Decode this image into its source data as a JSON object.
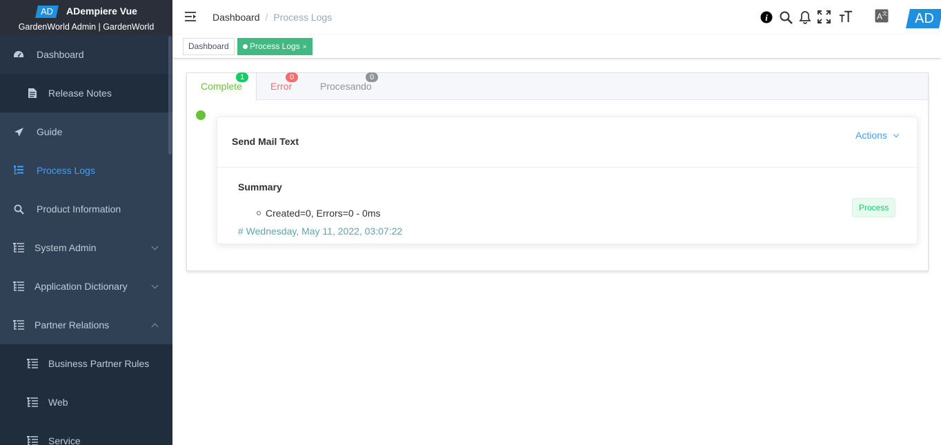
{
  "brand": {
    "logo_text": "AD",
    "app_name": "ADempiere Vue",
    "org": "GardenWorld Admin | GardenWorld"
  },
  "sidebar": {
    "items": [
      {
        "label": "Dashboard",
        "icon": "dashboard-icon"
      },
      {
        "label": "Release Notes",
        "icon": "document-icon"
      },
      {
        "label": "Guide",
        "icon": "paper-plane-icon"
      },
      {
        "label": "Process Logs",
        "icon": "tree-table-icon",
        "active": true
      },
      {
        "label": "Product Information",
        "icon": "search-icon"
      },
      {
        "label": "System Admin",
        "icon": "tree-icon",
        "expanded": false
      },
      {
        "label": "Application Dictionary",
        "icon": "tree-icon",
        "expanded": false
      },
      {
        "label": "Partner Relations",
        "icon": "tree-icon",
        "expanded": true
      },
      {
        "label": "Business Partner Rules",
        "icon": "tree-icon"
      },
      {
        "label": "Web",
        "icon": "tree-icon"
      },
      {
        "label": "Service",
        "icon": "tree-icon"
      }
    ]
  },
  "navbar": {
    "breadcrumb": [
      "Dashboard",
      "Process Logs"
    ],
    "logo_text": "AD"
  },
  "tags": {
    "dashboard": "Dashboard",
    "process_logs": "Process Logs",
    "close": "×"
  },
  "tabs": [
    {
      "label": "Complete",
      "count": "1"
    },
    {
      "label": "Error",
      "count": "0"
    },
    {
      "label": "Procesando",
      "count": "0"
    }
  ],
  "log": {
    "title": "Send Mail Text",
    "actions_label": "Actions",
    "summary_title": "Summary",
    "summary_text": "Created=0, Errors=0 - 0ms",
    "date": "# Wednesday, May 11, 2022, 03:07:22",
    "tag": "Process"
  },
  "colors": {
    "sidebar_bg": "#304156",
    "brand_bg": "#2b2f3a",
    "accent": "#409eff",
    "success": "#67c23a",
    "error": "#f56c6c",
    "tag_active": "#42b983"
  }
}
